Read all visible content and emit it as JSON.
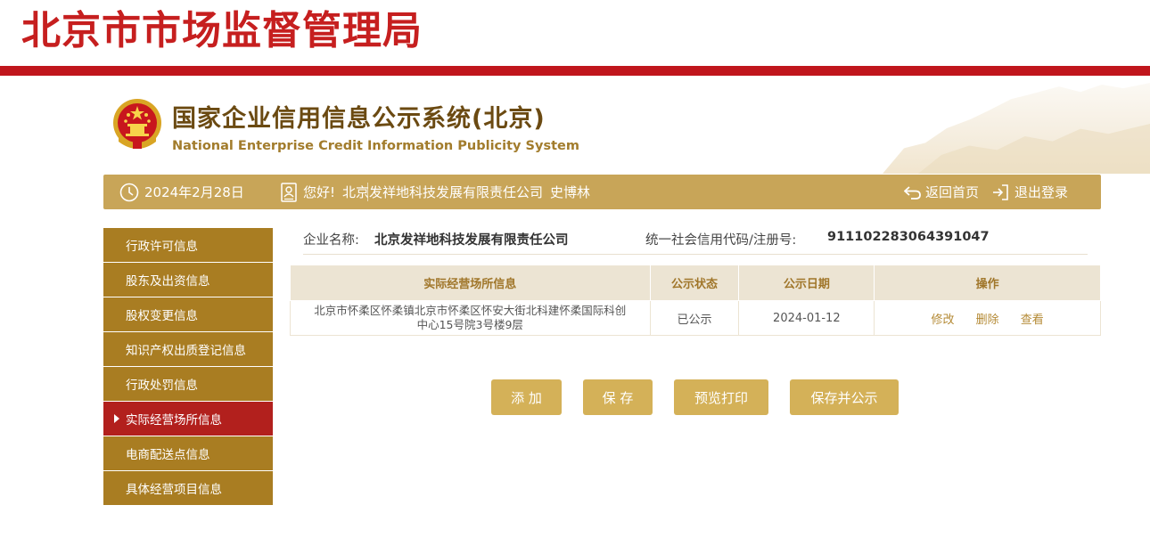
{
  "header": {
    "bureau_title": "北京市市场监督管理局",
    "system_title_cn": "国家企业信用信息公示系统(北京)",
    "system_title_en": "National Enterprise Credit Information Publicity System"
  },
  "topbar": {
    "date": "2024年2月28日",
    "greeting": "您好!",
    "company": "北京发祥地科技发展有限责任公司",
    "user": "史博林",
    "home_label": "返回首页",
    "logout_label": "退出登录"
  },
  "sidebar": {
    "items": [
      {
        "label": "行政许可信息"
      },
      {
        "label": "股东及出资信息"
      },
      {
        "label": "股权变更信息"
      },
      {
        "label": "知识产权出质登记信息"
      },
      {
        "label": "行政处罚信息"
      },
      {
        "label": "实际经营场所信息"
      },
      {
        "label": "电商配送点信息"
      },
      {
        "label": "具体经营项目信息"
      }
    ],
    "active_index": 5
  },
  "company_info": {
    "name_label": "企业名称:",
    "name_value": "北京发祥地科技发展有限责任公司",
    "code_label": "统一社会信用代码/注册号:",
    "code_value": "911102283064391047"
  },
  "table": {
    "headers": [
      "实际经营场所信息",
      "公示状态",
      "公示日期",
      "操作"
    ],
    "rows": [
      {
        "address_line1": "北京市怀柔区怀柔镇北京市怀柔区怀安大街北科建怀柔国际科创",
        "address_line2": "中心15号院3号楼9层",
        "status": "已公示",
        "date": "2024-01-12",
        "actions": [
          "修改",
          "删除",
          "查看"
        ]
      }
    ]
  },
  "buttons": {
    "add": "添 加",
    "save": "保 存",
    "preview": "预览打印",
    "save_publish": "保存并公示"
  },
  "colors": {
    "brand_red": "#c0161c",
    "gold": "#c8a558",
    "sidebar_gold": "#a97d22",
    "sidebar_active": "#b2201d"
  }
}
